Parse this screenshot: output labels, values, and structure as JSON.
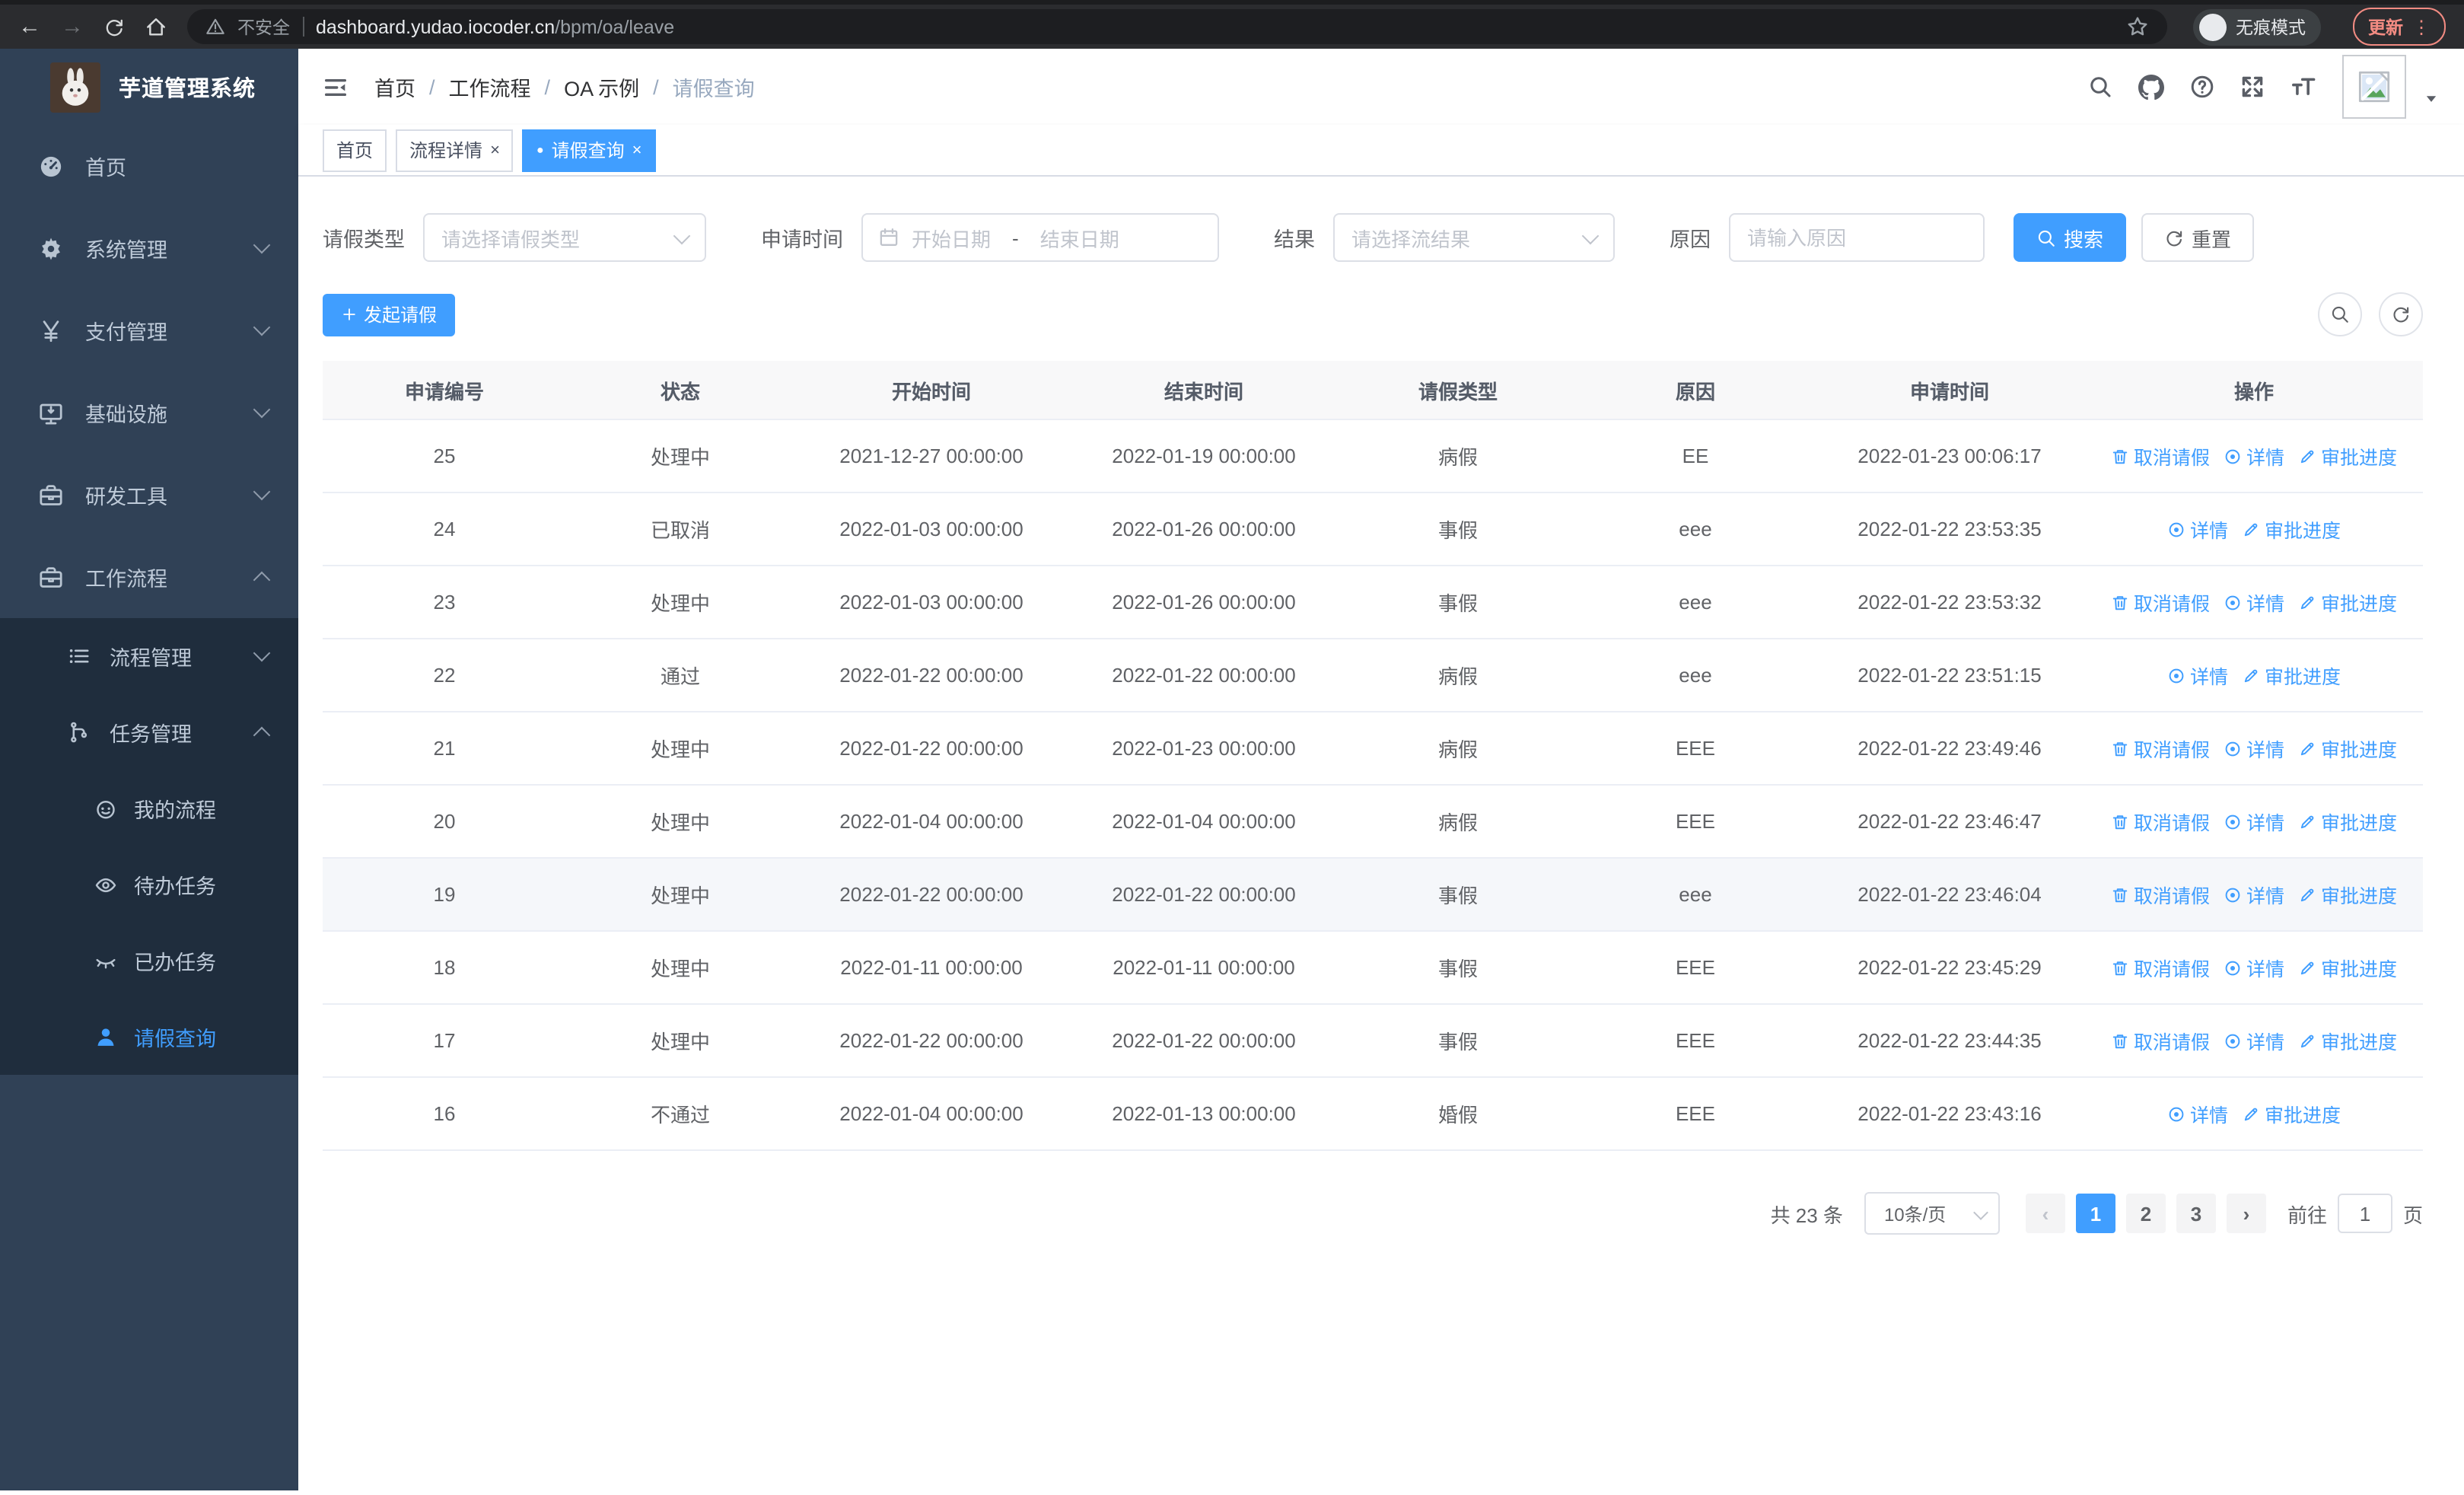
{
  "browser": {
    "back_glyph": "←",
    "forward_glyph": "→",
    "security_chip": "不安全",
    "url_host": "dashboard.yudao.iocoder.cn",
    "url_path": "/bpm/oa/leave",
    "incognito_label": "无痕模式",
    "update_button": "更新",
    "menu_dots_glyph": "⋮"
  },
  "sidebar": {
    "app_title": "芋道管理系统",
    "items": [
      {
        "label": "首页"
      },
      {
        "label": "系统管理"
      },
      {
        "label": "支付管理"
      },
      {
        "label": "基础设施"
      },
      {
        "label": "研发工具"
      },
      {
        "label": "工作流程"
      },
      {
        "label": "流程管理"
      },
      {
        "label": "任务管理"
      },
      {
        "label": "我的流程"
      },
      {
        "label": "待办任务"
      },
      {
        "label": "已办任务"
      },
      {
        "label": "请假查询"
      }
    ]
  },
  "header": {
    "breadcrumb": [
      "首页",
      "工作流程",
      "OA 示例",
      "请假查询"
    ],
    "separator": "/"
  },
  "tabs": {
    "dot_glyph": "●",
    "close_glyph": "×",
    "items": [
      {
        "label": "首页"
      },
      {
        "label": "流程详情"
      },
      {
        "label": "请假查询"
      }
    ]
  },
  "filters": {
    "leave_type_label": "请假类型",
    "leave_type_placeholder": "请选择请假类型",
    "apply_time_label": "申请时间",
    "start_date_placeholder": "开始日期",
    "range_separator": "-",
    "end_date_placeholder": "结束日期",
    "result_label": "结果",
    "result_placeholder": "请选择流结果",
    "reason_label": "原因",
    "reason_placeholder": "请输入原因",
    "search_button": "搜索",
    "reset_button": "重置"
  },
  "toolbar": {
    "plus_glyph": "+",
    "create_button": "发起请假"
  },
  "table": {
    "headers": [
      "申请编号",
      "状态",
      "开始时间",
      "结束时间",
      "请假类型",
      "原因",
      "申请时间",
      "操作"
    ],
    "actions": {
      "cancel": "取消请假",
      "detail": "详情",
      "progress": "审批进度"
    },
    "rows": [
      {
        "id": "25",
        "status": "处理中",
        "start": "2021-12-27 00:00:00",
        "end": "2022-01-19 00:00:00",
        "type": "病假",
        "reason": "EE",
        "applied": "2022-01-23 00:06:17"
      },
      {
        "id": "24",
        "status": "已取消",
        "start": "2022-01-03 00:00:00",
        "end": "2022-01-26 00:00:00",
        "type": "事假",
        "reason": "eee",
        "applied": "2022-01-22 23:53:35"
      },
      {
        "id": "23",
        "status": "处理中",
        "start": "2022-01-03 00:00:00",
        "end": "2022-01-26 00:00:00",
        "type": "事假",
        "reason": "eee",
        "applied": "2022-01-22 23:53:32"
      },
      {
        "id": "22",
        "status": "通过",
        "start": "2022-01-22 00:00:00",
        "end": "2022-01-22 00:00:00",
        "type": "病假",
        "reason": "eee",
        "applied": "2022-01-22 23:51:15"
      },
      {
        "id": "21",
        "status": "处理中",
        "start": "2022-01-22 00:00:00",
        "end": "2022-01-23 00:00:00",
        "type": "病假",
        "reason": "EEE",
        "applied": "2022-01-22 23:49:46"
      },
      {
        "id": "20",
        "status": "处理中",
        "start": "2022-01-04 00:00:00",
        "end": "2022-01-04 00:00:00",
        "type": "病假",
        "reason": "EEE",
        "applied": "2022-01-22 23:46:47"
      },
      {
        "id": "19",
        "status": "处理中",
        "start": "2022-01-22 00:00:00",
        "end": "2022-01-22 00:00:00",
        "type": "事假",
        "reason": "eee",
        "applied": "2022-01-22 23:46:04"
      },
      {
        "id": "18",
        "status": "处理中",
        "start": "2022-01-11 00:00:00",
        "end": "2022-01-11 00:00:00",
        "type": "事假",
        "reason": "EEE",
        "applied": "2022-01-22 23:45:29"
      },
      {
        "id": "17",
        "status": "处理中",
        "start": "2022-01-22 00:00:00",
        "end": "2022-01-22 00:00:00",
        "type": "事假",
        "reason": "EEE",
        "applied": "2022-01-22 23:44:35"
      },
      {
        "id": "16",
        "status": "不通过",
        "start": "2022-01-04 00:00:00",
        "end": "2022-01-13 00:00:00",
        "type": "婚假",
        "reason": "EEE",
        "applied": "2022-01-22 23:43:16"
      }
    ]
  },
  "pagination": {
    "total": "共 23 条",
    "page_size": "10条/页",
    "prev_glyph": "‹",
    "pages": [
      "1",
      "2",
      "3"
    ],
    "next_glyph": "›",
    "goto_label": "前往",
    "goto_value": "1",
    "goto_unit": "页"
  },
  "colors": {
    "accent": "#409EFF",
    "sidebar_bg": "#304156",
    "submenu_bg": "#1F2D3D",
    "table_border": "#EBEEF5",
    "update_accent": "#F28B82"
  }
}
